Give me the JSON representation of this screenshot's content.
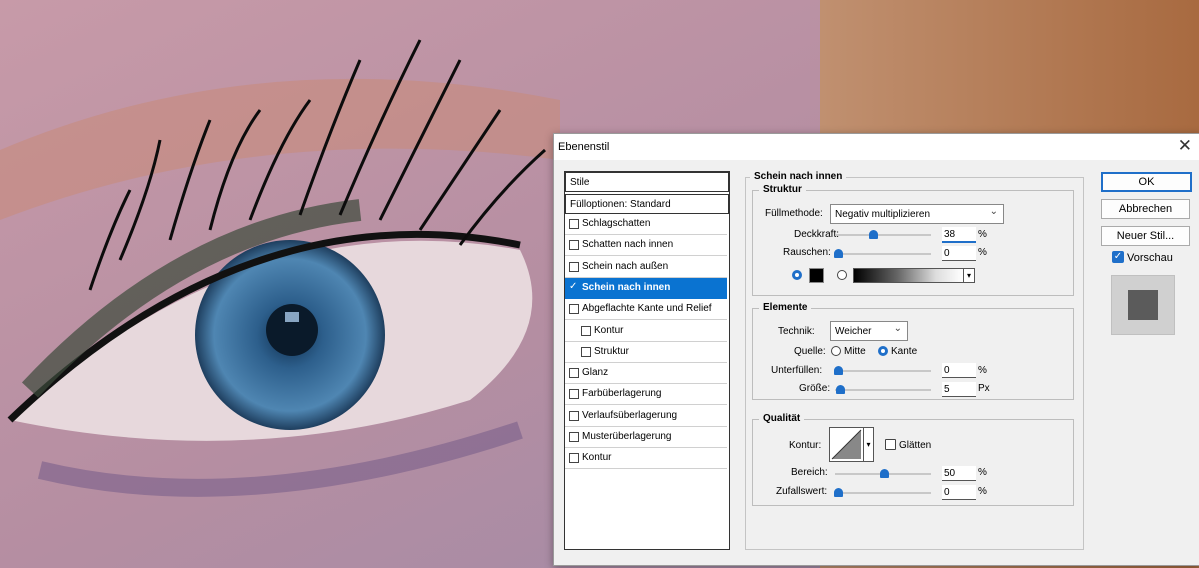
{
  "dialog": {
    "title": "Ebenenstil",
    "close": "✕"
  },
  "styles_list": {
    "header": "Stile",
    "fill_options": "Fülloptionen: Standard",
    "items": [
      {
        "label": "Schlagschatten",
        "checked": false
      },
      {
        "label": "Schatten nach innen",
        "checked": false
      },
      {
        "label": "Schein nach außen",
        "checked": false
      },
      {
        "label": "Schein nach innen",
        "checked": true,
        "selected": true
      },
      {
        "label": "Abgeflachte Kante und Relief",
        "checked": false
      },
      {
        "label": "Kontur",
        "checked": false
      },
      {
        "label": "Struktur",
        "checked": false
      },
      {
        "label": "Glanz",
        "checked": false
      },
      {
        "label": "Farbüberlagerung",
        "checked": false
      },
      {
        "label": "Verlaufsüberlagerung",
        "checked": false
      },
      {
        "label": "Musterüberlagerung",
        "checked": false
      },
      {
        "label": "Kontur",
        "checked": false
      }
    ]
  },
  "panel": {
    "title": "Schein nach innen",
    "structure": {
      "title": "Struktur",
      "blend_label": "Füllmethode:",
      "blend_value": "Negativ multiplizieren",
      "opacity_label": "Deckkraft:",
      "opacity_value": "38",
      "opacity_fraction": 0.38,
      "noise_label": "Rauschen:",
      "noise_value": "0",
      "noise_fraction": 0,
      "percent": "%"
    },
    "elements": {
      "title": "Elemente",
      "technique_label": "Technik:",
      "technique_value": "Weicher",
      "source_label": "Quelle:",
      "source_center": "Mitte",
      "source_edge": "Kante",
      "choke_label": "Unterfüllen:",
      "choke_value": "0",
      "choke_fraction": 0,
      "size_label": "Größe:",
      "size_value": "5",
      "size_fraction": 0.02,
      "px": "Px"
    },
    "quality": {
      "title": "Qualität",
      "contour_label": "Kontur:",
      "antialias_label": "Glätten",
      "range_label": "Bereich:",
      "range_value": "50",
      "range_fraction": 0.5,
      "jitter_label": "Zufallswert:",
      "jitter_value": "0",
      "jitter_fraction": 0
    }
  },
  "buttons": {
    "ok": "OK",
    "cancel": "Abbrechen",
    "new_style": "Neuer Stil...",
    "preview": "Vorschau"
  },
  "colors": {
    "accent": "#1f6fc9",
    "selection": "#0a73d1",
    "glow_color": "#000000",
    "preview_swatch": "#5b5b5b"
  }
}
